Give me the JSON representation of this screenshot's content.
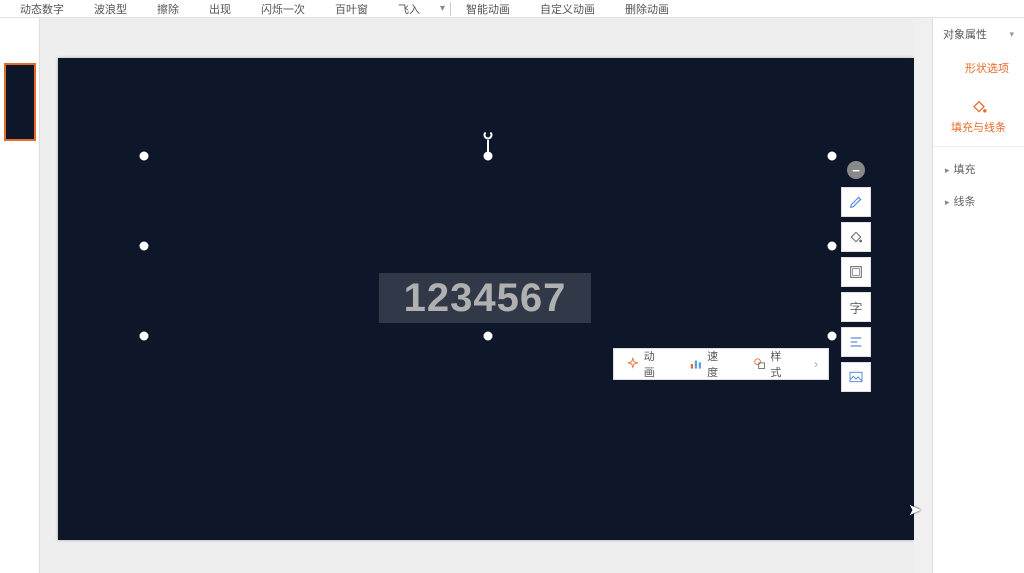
{
  "toolbar": {
    "items": [
      "动态数字",
      "波浪型",
      "擦除",
      "出现",
      "闪烁一次",
      "百叶窗",
      "飞入"
    ],
    "right": [
      "智能动画",
      "自定义动画",
      "删除动画"
    ]
  },
  "slide": {
    "text_content": "1234567"
  },
  "context_toolbar": {
    "anim": "动画",
    "speed": "速度",
    "style": "样式"
  },
  "vertical_toolbar": {
    "remove": "−",
    "char_btn": "字"
  },
  "right_panel": {
    "header": "对象属性",
    "tab_shape": "形状选项",
    "fill_stroke": "填充与线条",
    "fill": "填充",
    "stroke": "线条"
  }
}
